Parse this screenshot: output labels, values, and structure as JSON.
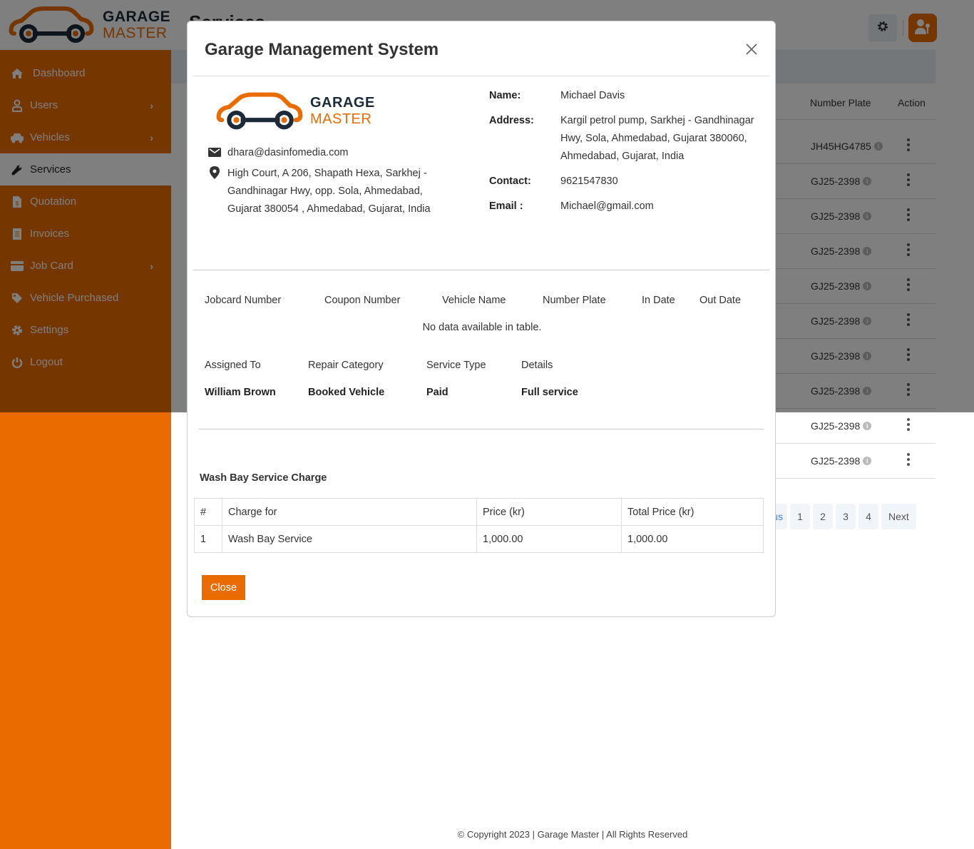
{
  "brand": {
    "line1": "GARAGE",
    "line2": "MASTER"
  },
  "sidebar": {
    "items": [
      {
        "label": "Dashboard",
        "icon": "home-icon",
        "has_children": false,
        "active": false
      },
      {
        "label": "Users",
        "icon": "user-icon",
        "has_children": true,
        "active": false
      },
      {
        "label": "Vehicles",
        "icon": "car-icon",
        "has_children": true,
        "active": false
      },
      {
        "label": "Services",
        "icon": "wrench-icon",
        "has_children": false,
        "active": true
      },
      {
        "label": "Quotation",
        "icon": "quotation-file-icon",
        "has_children": false,
        "active": false
      },
      {
        "label": "Invoices",
        "icon": "invoice-icon",
        "has_children": false,
        "active": false
      },
      {
        "label": "Job Card",
        "icon": "credit-card-icon",
        "has_children": true,
        "active": false
      },
      {
        "label": "Vehicle Purchased",
        "icon": "tag-icon",
        "has_children": false,
        "active": false
      },
      {
        "label": "Settings",
        "icon": "gear-icon",
        "has_children": false,
        "active": false
      },
      {
        "label": "Logout",
        "icon": "power-icon",
        "has_children": false,
        "active": false
      }
    ]
  },
  "page": {
    "title": "Services",
    "table_headers": {
      "number_plate": "Number Plate",
      "action": "Action"
    },
    "rows": [
      {
        "plate": "JH45HG4785"
      },
      {
        "plate": "GJ25-2398"
      },
      {
        "plate": "GJ25-2398"
      },
      {
        "plate": "GJ25-2398"
      },
      {
        "plate": "GJ25-2398"
      },
      {
        "plate": "GJ25-2398"
      },
      {
        "plate": "GJ25-2398"
      },
      {
        "plate": "GJ25-2398"
      },
      {
        "plate": "GJ25-2398"
      },
      {
        "plate": "GJ25-2398"
      }
    ],
    "pagination": {
      "previous": "Previous",
      "pages": [
        "1",
        "2",
        "3",
        "4"
      ],
      "next": "Next"
    },
    "footer": "© Copyright 2023 | Garage Master | All Rights Reserved"
  },
  "colors": {
    "brand_orange": "#ea6c00",
    "brand_navy": "#1d2a3a"
  },
  "modal": {
    "title": "Garage Management System",
    "company": {
      "email": "dhara@dasinfomedia.com",
      "address": "High Court, A 206, Shapath Hexa, Sarkhej - Gandhinagar Hwy, opp. Sola, Ahmedabad, Gujarat 380054 , Ahmedabad, Gujarat, India"
    },
    "customer": {
      "name_label": "Name:",
      "name": "Michael Davis",
      "address_label": "Address:",
      "address": "Kargil petrol pump, Sarkhej - Gandhinagar Hwy, Sola, Ahmedabad, Gujarat 380060, Ahmedabad, Gujarat, India",
      "contact_label": "Contact:",
      "contact": "9621547830",
      "email_label": "Email :",
      "email": "Michael@gmail.com"
    },
    "jobcard_headers": [
      "Jobcard Number",
      "Coupon Number",
      "Vehicle Name",
      "Number Plate",
      "In Date",
      "Out Date"
    ],
    "jobcard_empty": "No data available in table.",
    "service_headers": [
      "Assigned To",
      "Repair Category",
      "Service Type",
      "Details"
    ],
    "service_values": [
      "William Brown",
      "Booked Vehicle",
      "Paid",
      "Full service"
    ],
    "wash_bay": {
      "title": "Wash Bay Service Charge",
      "headers": [
        "#",
        "Charge for",
        "Price (kr)",
        "Total Price (kr)"
      ],
      "rows": [
        [
          "1",
          "Wash Bay Service",
          "1,000.00",
          "1,000.00"
        ]
      ]
    },
    "close_label": "Close"
  }
}
